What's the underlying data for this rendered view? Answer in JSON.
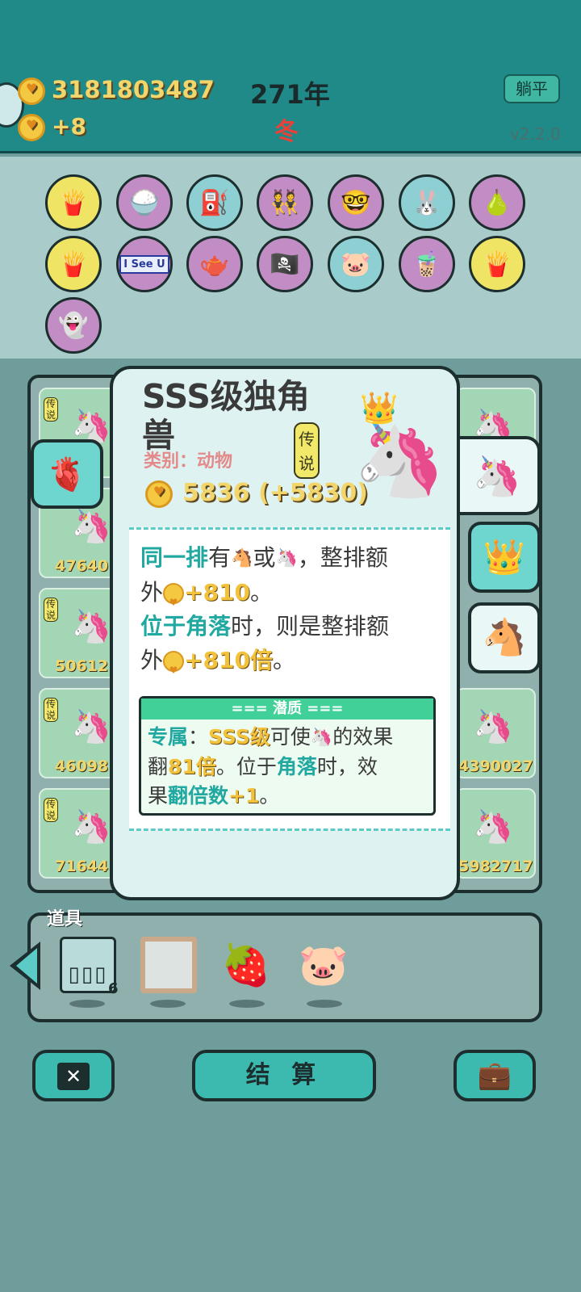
{
  "header": {
    "money": "3181803487",
    "income": "+8",
    "year": "271年",
    "season": "冬",
    "lie_flat_button": "躺平",
    "version": "v2.2.0"
  },
  "collection": {
    "row1": [
      "fries-icon",
      "rice-bowl-icon",
      "pump-icon",
      "twins-icon",
      "math-head-icon",
      "rabbit-icon",
      "guava-icon"
    ],
    "row2": [
      "fries-icon",
      "i-see-u-sign",
      "gravy-boat-icon",
      "eyepatch-icon",
      "piggy-bank-icon",
      "milk-tea-icon",
      "fries-icon"
    ],
    "row3": [
      "ghost-icon"
    ],
    "i_see_u_text": "I See U"
  },
  "board": {
    "tag": "传说",
    "cells": [
      {
        "num": ""
      },
      {
        "num": "47640"
      },
      {
        "num": "50612"
      },
      {
        "num": "46098"
      },
      {
        "num": "71644"
      }
    ],
    "right_cells": [
      {
        "num": ""
      },
      {
        "num": ""
      },
      {
        "num": "4390027"
      },
      {
        "num": "5982717"
      }
    ]
  },
  "popup": {
    "title_line1": "SSS级独角",
    "title_line2": "兽",
    "category": "类别：动物",
    "rarity": "传说",
    "value": "5836 (+5830)",
    "desc": {
      "p1_a": "同一排",
      "p1_b": "有",
      "p1_c": "或",
      "p1_d": "，整排额",
      "p1_e": "外",
      "p1_f": "+810",
      "p1_g": "。",
      "p2_a": "位于角落",
      "p2_b": "时，则是整排额",
      "p2_c": "外",
      "p2_d": "+810倍",
      "p2_e": "。"
    },
    "potential": {
      "header": "=== 潜质 ===",
      "t1": "专属",
      "t2": "：",
      "t3": "SSS级",
      "t4": "可使",
      "t5": "的效果",
      "t6": "翻",
      "t7": "81倍",
      "t8": "。位于",
      "t9": "角落",
      "t10": "时，效",
      "t11": "果",
      "t12": "翻倍数",
      "t13": "+1",
      "t14": "。"
    }
  },
  "props": {
    "label": "道具",
    "cage_count": "6",
    "items": [
      "cage-icon",
      "frame-icon",
      "strawberry-icon",
      "piggy-bank-icon"
    ]
  },
  "footer": {
    "settle_label": "结 算",
    "close_symbol": "✕",
    "bag_symbol": "💼"
  },
  "colors": {
    "top_bar": "#1f8a88",
    "gold": "#f2d66b",
    "teal_highlight": "#21a8a0"
  }
}
